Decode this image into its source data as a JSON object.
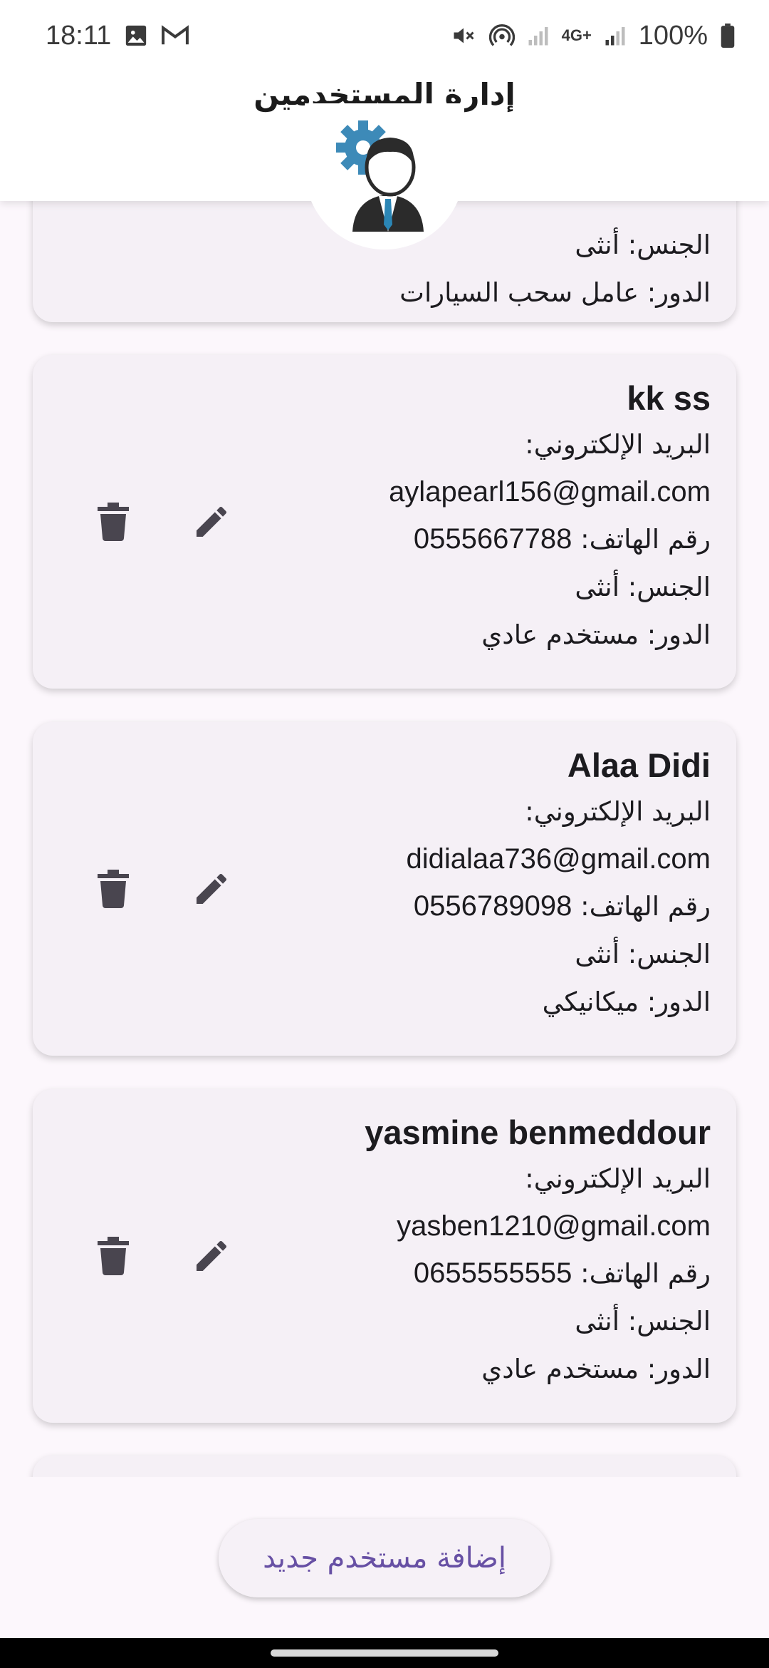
{
  "status_bar": {
    "time": "18:11",
    "battery": "100%",
    "network": "4G+",
    "icons": [
      "gallery-icon",
      "gmail-icon",
      "mute-icon",
      "hotspot-icon",
      "signal-icon",
      "battery-icon"
    ]
  },
  "app_bar": {
    "title": "إدارة المستخدمين",
    "avatar_icon": "user-settings-icon"
  },
  "labels": {
    "email": "البريد الإلكتروني:",
    "phone": "رقم الهاتف:",
    "gender": "الجنس:",
    "role": "الدور:"
  },
  "users": [
    {
      "gender_line": "الجنس: أنثى",
      "role_line": "الدور: عامل سحب السيارات"
    },
    {
      "name": "kk ss",
      "email_label": "البريد الإلكتروني:",
      "email": "aylapearl156@gmail.com",
      "phone_label": "رقم الهاتف:",
      "phone": "0555667788",
      "gender_line": "الجنس: أنثى",
      "role_line": "الدور: مستخدم عادي"
    },
    {
      "name": "Alaa Didi",
      "email_label": "البريد الإلكتروني:",
      "email": "didialaa736@gmail.com",
      "phone_label": "رقم الهاتف:",
      "phone": "0556789098",
      "gender_line": "الجنس: أنثى",
      "role_line": "الدور: ميكانيكي"
    },
    {
      "name": "yasmine benmeddour",
      "email_label": "البريد الإلكتروني:",
      "email": "yasben1210@gmail.com",
      "phone_label": "رقم الهاتف:",
      "phone": "0655555555",
      "gender_line": "الجنس: أنثى",
      "role_line": "الدور: مستخدم عادي"
    }
  ],
  "actions": {
    "delete_icon": "trash-icon",
    "edit_icon": "pencil-icon"
  },
  "add_button": {
    "label": "إضافة مستخدم جديد"
  },
  "colors": {
    "accent": "#6750a4",
    "icon": "#49454f",
    "card": "#f5f0f6",
    "background": "#fcf7fc"
  }
}
